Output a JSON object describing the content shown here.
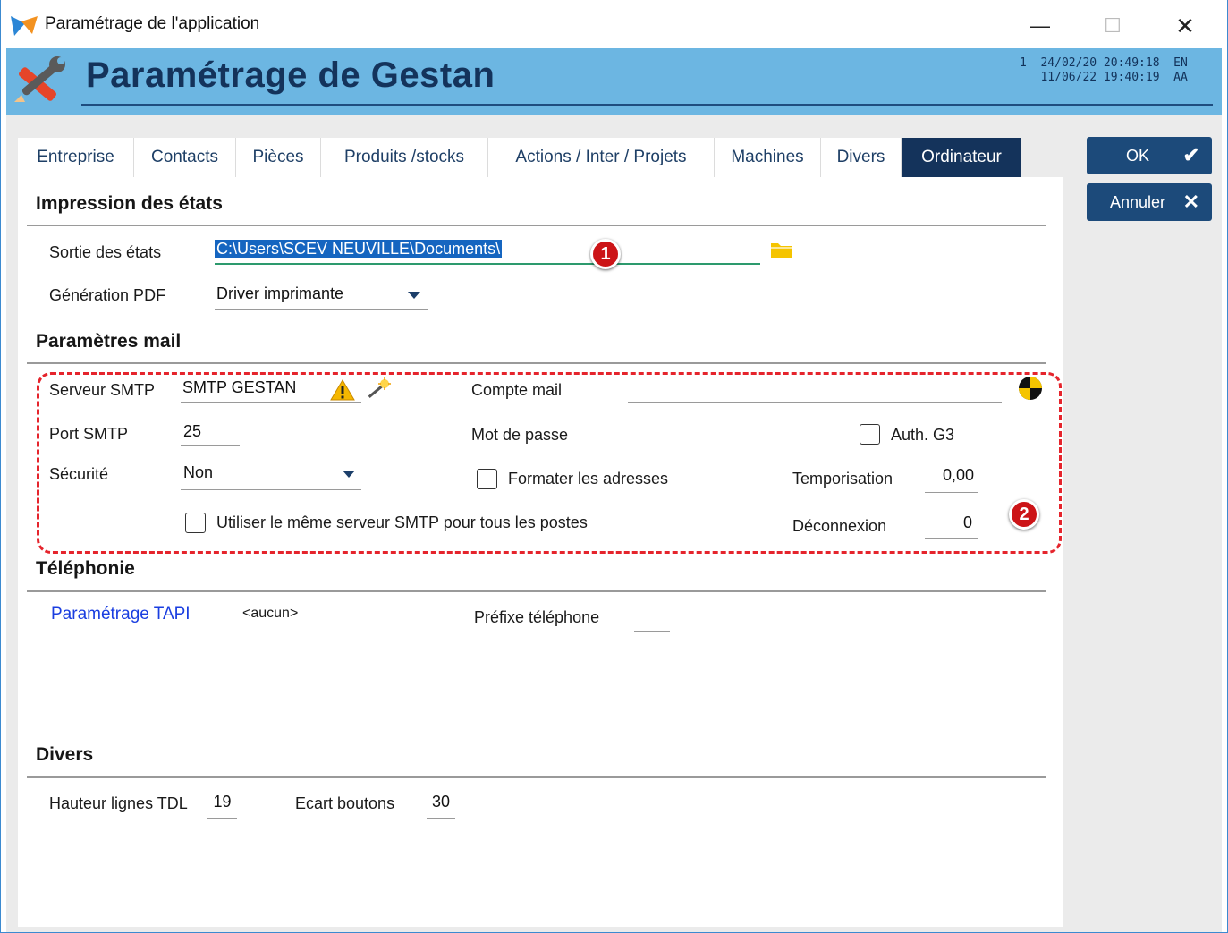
{
  "window": {
    "title": "Paramétrage de l'application",
    "minimize": "—",
    "maximize": "☐",
    "close": "✕"
  },
  "header": {
    "title": "Paramétrage de Gestan",
    "info_line1": "1  24/02/20 20:49:18  EN",
    "info_line2": "   11/06/22 19:40:19  AA"
  },
  "tabs": [
    {
      "label": "Entreprise"
    },
    {
      "label": "Contacts"
    },
    {
      "label": "Pièces"
    },
    {
      "label": "Produits /stocks"
    },
    {
      "label": "Actions / Inter / Projets"
    },
    {
      "label": "Machines"
    },
    {
      "label": "Divers"
    },
    {
      "label": "Ordinateur",
      "active": true
    }
  ],
  "buttons": {
    "ok": "OK",
    "ok_icon": "✔",
    "cancel": "Annuler",
    "cancel_icon": "✕"
  },
  "impression": {
    "title": "Impression des états",
    "sortie_label": "Sortie des états",
    "sortie_value": "C:\\Users\\SCEV NEUVILLE\\Documents\\",
    "pdf_label": "Génération PDF",
    "pdf_value": "Driver imprimante"
  },
  "mail": {
    "title": "Paramètres mail",
    "smtp_server_label": "Serveur SMTP",
    "smtp_server_value": "SMTP GESTAN",
    "account_label": "Compte mail",
    "account_value": "",
    "port_label": "Port SMTP",
    "port_value": "25",
    "password_label": "Mot de passe",
    "password_value": "",
    "auth_label": "Auth. G3",
    "security_label": "Sécurité",
    "security_value": "Non",
    "format_label": "Formater les adresses",
    "timeout_label": "Temporisation",
    "timeout_value": "0,00",
    "same_server_label": "Utiliser le même serveur SMTP pour tous les postes",
    "disconnect_label": "Déconnexion",
    "disconnect_value": "0"
  },
  "telephonie": {
    "title": "Téléphonie",
    "tapi_link": "Paramétrage TAPI",
    "tapi_value": "<aucun>",
    "prefix_label": "Préfixe téléphone",
    "prefix_value": ""
  },
  "divers": {
    "title": "Divers",
    "tdl_label": "Hauteur lignes TDL",
    "tdl_value": "19",
    "ecart_label": "Ecart boutons",
    "ecart_value": "30"
  },
  "badges": {
    "one": "1",
    "two": "2"
  },
  "colors": {
    "header_band": "#6cb6e2",
    "header_title": "#14335b",
    "active_tab": "#14335b",
    "button": "#1c4a7a",
    "highlight_box": "#e5242c",
    "link": "#1a3ee0"
  }
}
